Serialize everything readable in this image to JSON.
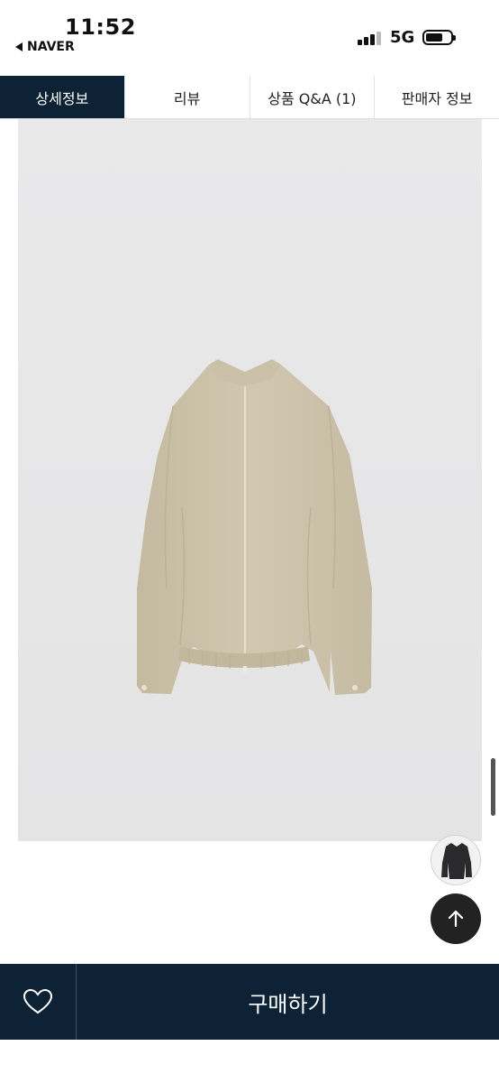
{
  "status": {
    "time": "11:52",
    "back_label": "NAVER",
    "network": "5G"
  },
  "tabs": [
    {
      "label": "상세정보",
      "active": true
    },
    {
      "label": "리뷰",
      "active": false
    },
    {
      "label": "상품 Q&A (1)",
      "active": false
    },
    {
      "label": "판매자 정보",
      "active": false
    }
  ],
  "product": {
    "image_icon": "jacket-photo"
  },
  "floating": {
    "thumbnail_icon": "coat-thumbnail-icon",
    "top_icon": "arrow-up-icon"
  },
  "bottom_bar": {
    "wish_icon": "heart-icon",
    "buy_label": "구매하기"
  },
  "colors": {
    "navy": "#0e2236",
    "image_bg": "#e7e7e7",
    "jacket": "#cdc3ab"
  }
}
